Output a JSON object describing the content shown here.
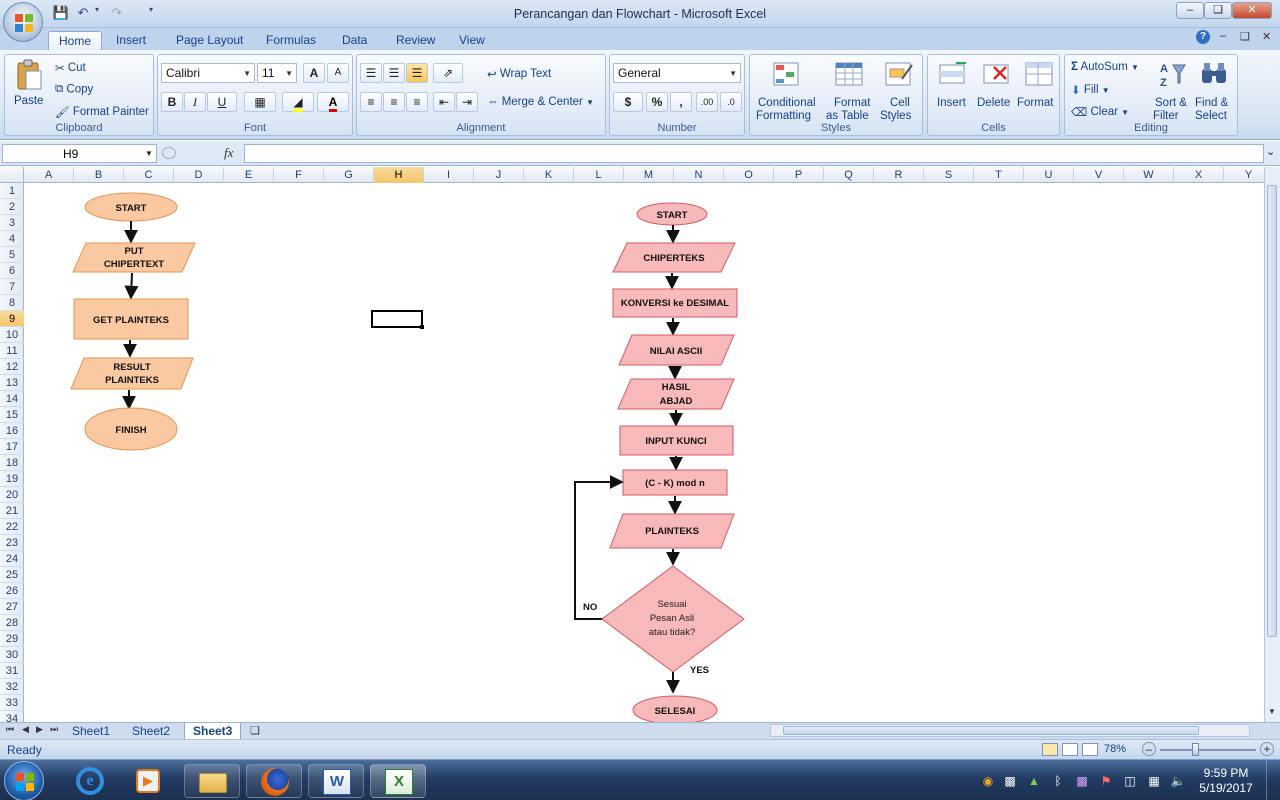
{
  "window": {
    "title": "Perancangan dan Flowchart - Microsoft Excel"
  },
  "ribbon_tabs": [
    "Home",
    "Insert",
    "Page Layout",
    "Formulas",
    "Data",
    "Review",
    "View"
  ],
  "clipboard": {
    "paste": "Paste",
    "cut": "Cut",
    "copy": "Copy",
    "format_painter": "Format Painter",
    "label": "Clipboard"
  },
  "font": {
    "name": "Calibri",
    "size": "11",
    "label": "Font",
    "bold": "B",
    "italic": "I",
    "underline": "U",
    "grow": "A",
    "shrink": "A",
    "font_color": "A"
  },
  "alignment": {
    "wrap_text": "Wrap Text",
    "merge_center": "Merge & Center",
    "label": "Alignment"
  },
  "number": {
    "format": "General",
    "currency": "$",
    "percent": "%",
    "comma": ",",
    "inc_decimal": ".00",
    "dec_decimal": ".0",
    "label": "Number"
  },
  "styles": {
    "conditional_formatting_1": "Conditional",
    "conditional_formatting_2": "Formatting",
    "format_table_1": "Format",
    "format_table_2": "as Table",
    "cell_styles_1": "Cell",
    "cell_styles_2": "Styles",
    "label": "Styles"
  },
  "cells": {
    "insert": "Insert",
    "delete": "Delete",
    "format": "Format",
    "label": "Cells"
  },
  "editing": {
    "autosum": "AutoSum",
    "fill": "Fill",
    "clear": "Clear",
    "sort_filter_1": "Sort &",
    "sort_filter_2": "Filter",
    "find_select_1": "Find &",
    "find_select_2": "Select",
    "label": "Editing"
  },
  "formula_bar": {
    "name_box": "H9",
    "fx": "fx",
    "formula": ""
  },
  "columns": [
    "A",
    "B",
    "C",
    "D",
    "E",
    "F",
    "G",
    "H",
    "I",
    "J",
    "K",
    "L",
    "M",
    "N",
    "O",
    "P",
    "Q",
    "R",
    "S",
    "T",
    "U",
    "V",
    "W",
    "X",
    "Y"
  ],
  "selected_column": "H",
  "rows": [
    "1",
    "2",
    "3",
    "4",
    "5",
    "6",
    "7",
    "8",
    "9",
    "10",
    "11",
    "12",
    "13",
    "14",
    "15",
    "16",
    "17",
    "18",
    "19",
    "20",
    "21",
    "22",
    "23",
    "24",
    "25",
    "26",
    "27",
    "28",
    "29",
    "30",
    "31",
    "32",
    "33",
    "34"
  ],
  "selected_row": "9",
  "flowchart_left": {
    "start": "START",
    "put_1": "PUT",
    "put_2": "CHIPERTEXT",
    "get": "GET PLAINTEKS",
    "result_1": "RESULT",
    "result_2": "PLAINTEKS",
    "finish": "FINISH"
  },
  "flowchart_right": {
    "start": "START",
    "chiperteks": "CHIPERTEKS",
    "konversi": "KONVERSI  ke DESIMAL",
    "nilai": "NILAI ASCII",
    "hasil_1": "HASIL",
    "hasil_2": "ABJAD",
    "input": "INPUT KUNCI",
    "mod": "(C - K)  mod n",
    "plainteks": "PLAINTEKS",
    "decision_1": "Sesuai",
    "decision_2": "Pesan Asli",
    "decision_3": "atau tidak?",
    "no": "NO",
    "yes": "YES",
    "selesai": "SELESAI"
  },
  "sheet_tabs": [
    "Sheet1",
    "Sheet2",
    "Sheet3"
  ],
  "active_sheet": "Sheet3",
  "status": {
    "ready": "Ready",
    "zoom": "78%"
  },
  "clock": {
    "time": "9:59 PM",
    "date": "5/19/2017"
  },
  "colors": {
    "left_fill": "#fbc9a1",
    "left_stroke": "#e39552",
    "right_fill": "#f8b9bb",
    "right_stroke": "#d65a60",
    "selection_header": "#f6c96e"
  }
}
